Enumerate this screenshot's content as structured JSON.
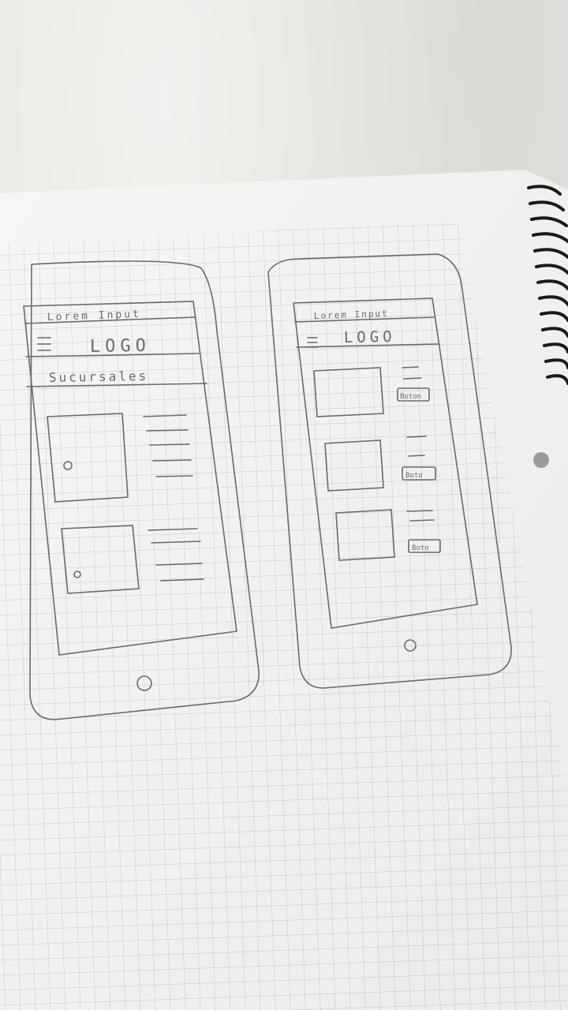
{
  "sketch": {
    "left_screen": {
      "header_text": "Lorem Input",
      "logo_text": "LOGO",
      "section_title": "Sucursales"
    },
    "right_screen": {
      "header_text": "Lorem Input",
      "logo_text": "LOGO",
      "button_labels": [
        "Boton",
        "Boto",
        "Boto"
      ]
    }
  },
  "colors": {
    "paper": "#f3f3f1",
    "grid": "#b9bcc2",
    "pencil": "#6a6a6a",
    "table": "#e6e4df",
    "spiral": "#1a1a1a"
  }
}
